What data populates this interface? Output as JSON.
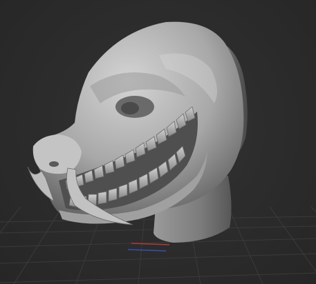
{
  "viewport": {
    "background_color": "#2a2a2a",
    "model_color": "#b5b5b5",
    "grid_color": "#3d3d3d",
    "axis_colors": {
      "x": "#b03a3a",
      "z": "#3a4fb0"
    }
  }
}
